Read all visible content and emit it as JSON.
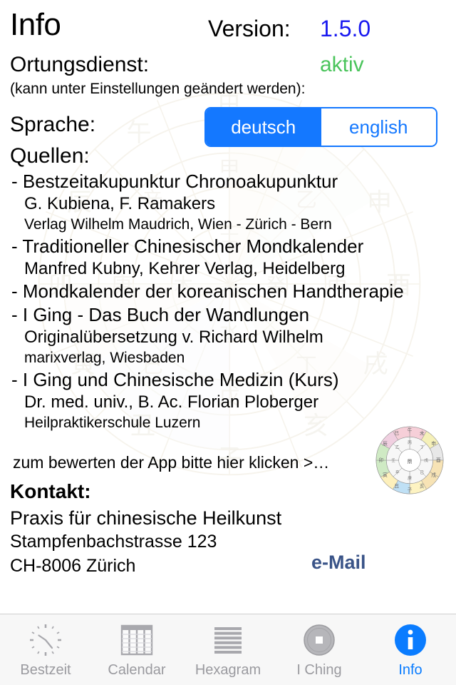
{
  "header": {
    "title": "Info",
    "version_label": "Version:",
    "version_value": "1.5.0"
  },
  "location": {
    "label": "Ortungsdienst:",
    "value": "aktiv",
    "note": "(kann unter Einstellungen geändert werden):"
  },
  "language": {
    "label": "Sprache:",
    "options": [
      {
        "label": "deutsch",
        "selected": true
      },
      {
        "label": "english",
        "selected": false
      }
    ]
  },
  "sources": {
    "label": "Quellen:",
    "items": [
      {
        "title": "- Bestzeitakupunktur Chronoakupunktur",
        "sub1": "G. Kubiena, F. Ramakers",
        "sub2": "Verlag Wilhelm Maudrich, Wien - Zürich - Bern"
      },
      {
        "title": "- Traditioneller Chinesischer Mondkalender",
        "sub1": "Manfred Kubny, Kehrer Verlag, Heidelberg",
        "sub2": ""
      },
      {
        "title": "- Mondkalender der koreanischen Handtherapie",
        "sub1": "",
        "sub2": ""
      },
      {
        "title": "- I Ging - Das Buch der Wandlungen",
        "sub1": "Originalübersetzung v. Richard Wilhelm",
        "sub2": "marixverlag, Wiesbaden"
      },
      {
        "title": "- I Ging und Chinesische Medizin (Kurs)",
        "sub1": "Dr. med. univ., B. Ac. Florian Ploberger",
        "sub2": "Heilpraktikerschule Luzern"
      }
    ]
  },
  "rate": {
    "text": "zum bewerten der App bitte hier klicken >…"
  },
  "contact": {
    "label": "Kontakt:",
    "line1": "Praxis für chinesische Heilkunst",
    "line2": "Stampfenbachstrasse 123",
    "line3": "CH-8006 Zürich",
    "email_label": "e-Mail"
  },
  "tabbar": {
    "items": [
      {
        "label": "Bestzeit",
        "icon": "clock-icon",
        "active": false
      },
      {
        "label": "Calendar",
        "icon": "table-icon",
        "active": false
      },
      {
        "label": "Hexagram",
        "icon": "hexagram-icon",
        "active": false
      },
      {
        "label": "I Ching",
        "icon": "coin-icon",
        "active": false
      },
      {
        "label": "Info",
        "icon": "info-icon",
        "active": true
      }
    ]
  },
  "colors": {
    "accent_blue": "#1478ff",
    "tab_active_blue": "#0a7cff",
    "version_blue": "#1818f0",
    "active_green": "#4ac45b",
    "email_blue": "#3a5488",
    "tab_inactive_gray": "#9a9a9f",
    "tabbar_bg": "#f7f7f7"
  }
}
